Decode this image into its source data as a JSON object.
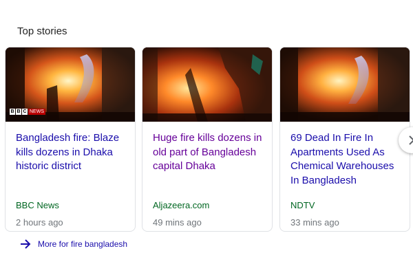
{
  "section": {
    "title": "Top stories"
  },
  "cards": [
    {
      "headline": "Bangladesh fire: Blaze kills dozens in Dhaka historic district",
      "source": "BBC News",
      "time": "2 hours ago",
      "visited": false,
      "logo": {
        "letters": [
          "B",
          "B",
          "C"
        ],
        "label": "NEWS"
      }
    },
    {
      "headline": "Huge fire kills dozens in old part of Bangladesh capital Dhaka",
      "source": "Aljazeera.com",
      "time": "49 mins ago",
      "visited": true
    },
    {
      "headline": "69 Dead In Fire In Apartments Used As Chemical Warehouses In Bangladesh",
      "source": "NDTV",
      "time": "33 mins ago",
      "visited": false
    }
  ],
  "carousel": {
    "next_icon": "chevron-right-icon"
  },
  "more_link": {
    "icon": "arrow-right-icon",
    "label": "More for fire bangladesh"
  },
  "colors": {
    "link": "#1a0dab",
    "visited": "#660099",
    "source": "#006621",
    "meta": "#70757a"
  }
}
